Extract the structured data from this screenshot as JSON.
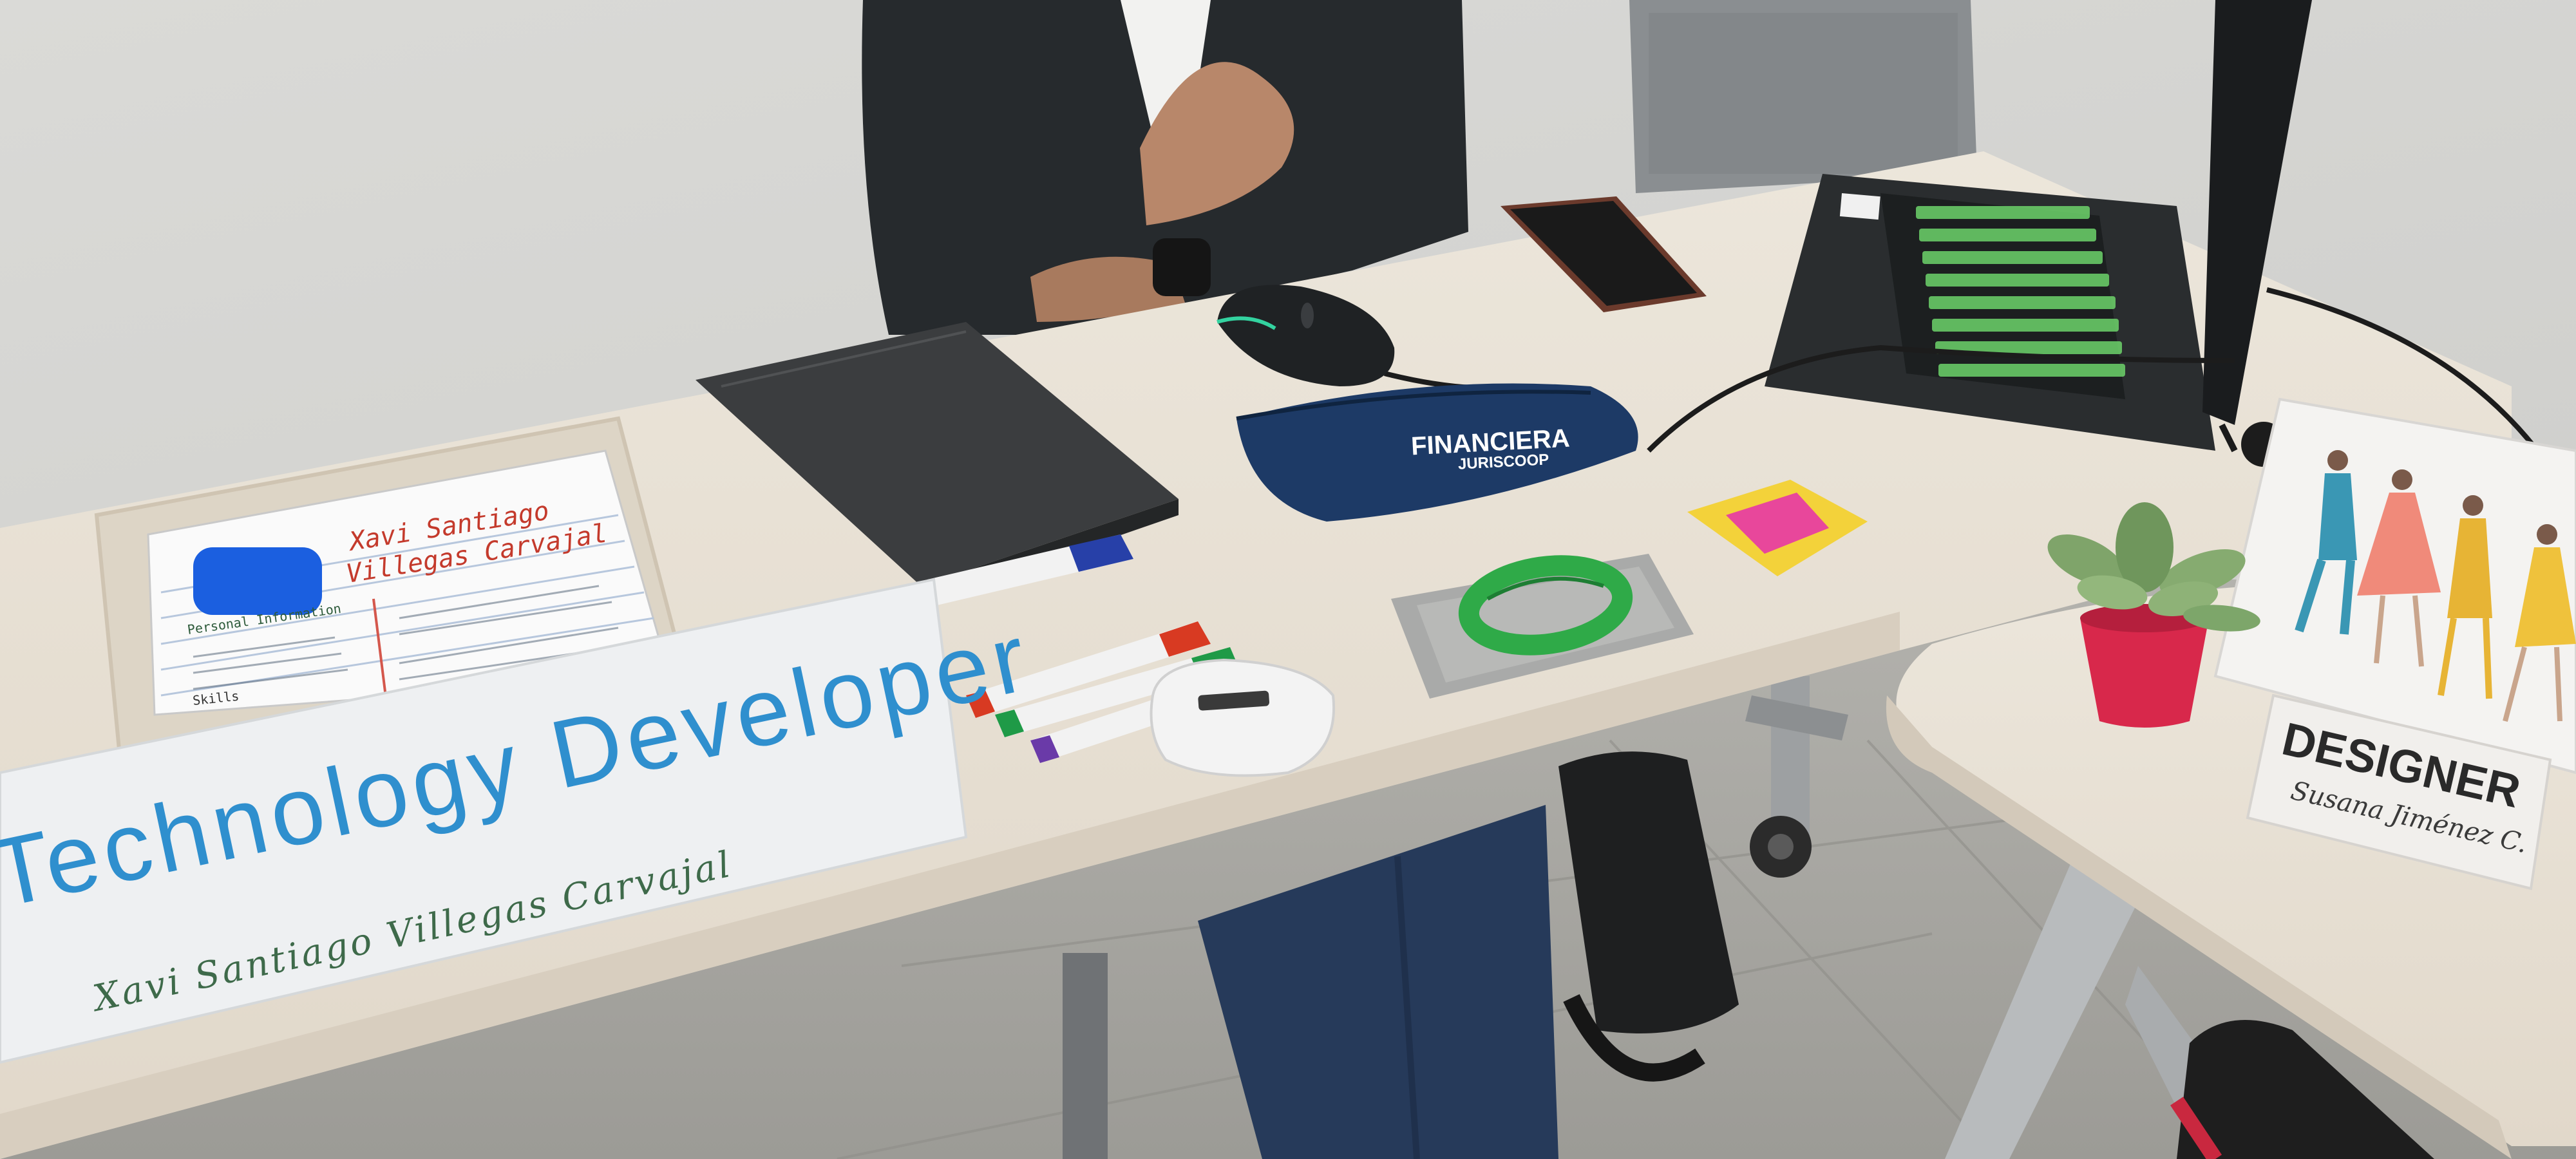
{
  "placard_left": {
    "title": "Technology Developer",
    "name": "Xavi Santiago Villegas Carvajal"
  },
  "resume_sheet": {
    "name_line1": "Xavi Santiago",
    "name_line2": "Villegas Carvajal",
    "section_label": "Personal Information",
    "skills_label": "Skills"
  },
  "pencil_case": {
    "brand_top": "FINANCIERA",
    "brand_bottom": "JURISCOOP"
  },
  "placard_right": {
    "title": "DESIGNER",
    "name": "Susana Jiménez C."
  },
  "colors": {
    "wall": "#d8d8d5",
    "desk": "#e9e1d5",
    "floor": "#a9a8a2",
    "blazer": "#272a2c",
    "placard_text": "#2f8fce",
    "placard_name": "#3e6a4a",
    "pencil_case": "#1d3a66",
    "bracelet": "#2faa48",
    "laptop_keys": "#6dd36a",
    "pot": "#d8284b"
  }
}
